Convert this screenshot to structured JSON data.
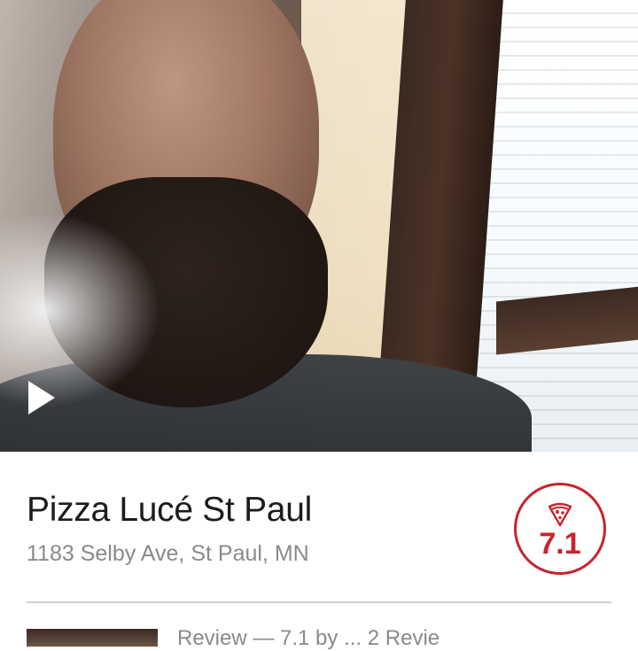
{
  "media": {
    "kind": "video",
    "play_icon": "play-icon"
  },
  "place": {
    "name": "Pizza Lucé St Paul",
    "address": "1183 Selby Ave, St Paul, MN"
  },
  "rating": {
    "icon": "pizza-slice-icon",
    "value": "7.1",
    "color": "#c8232c"
  },
  "review_preview": {
    "snippet": "Review — 7.1 by ... 2 Revie"
  }
}
